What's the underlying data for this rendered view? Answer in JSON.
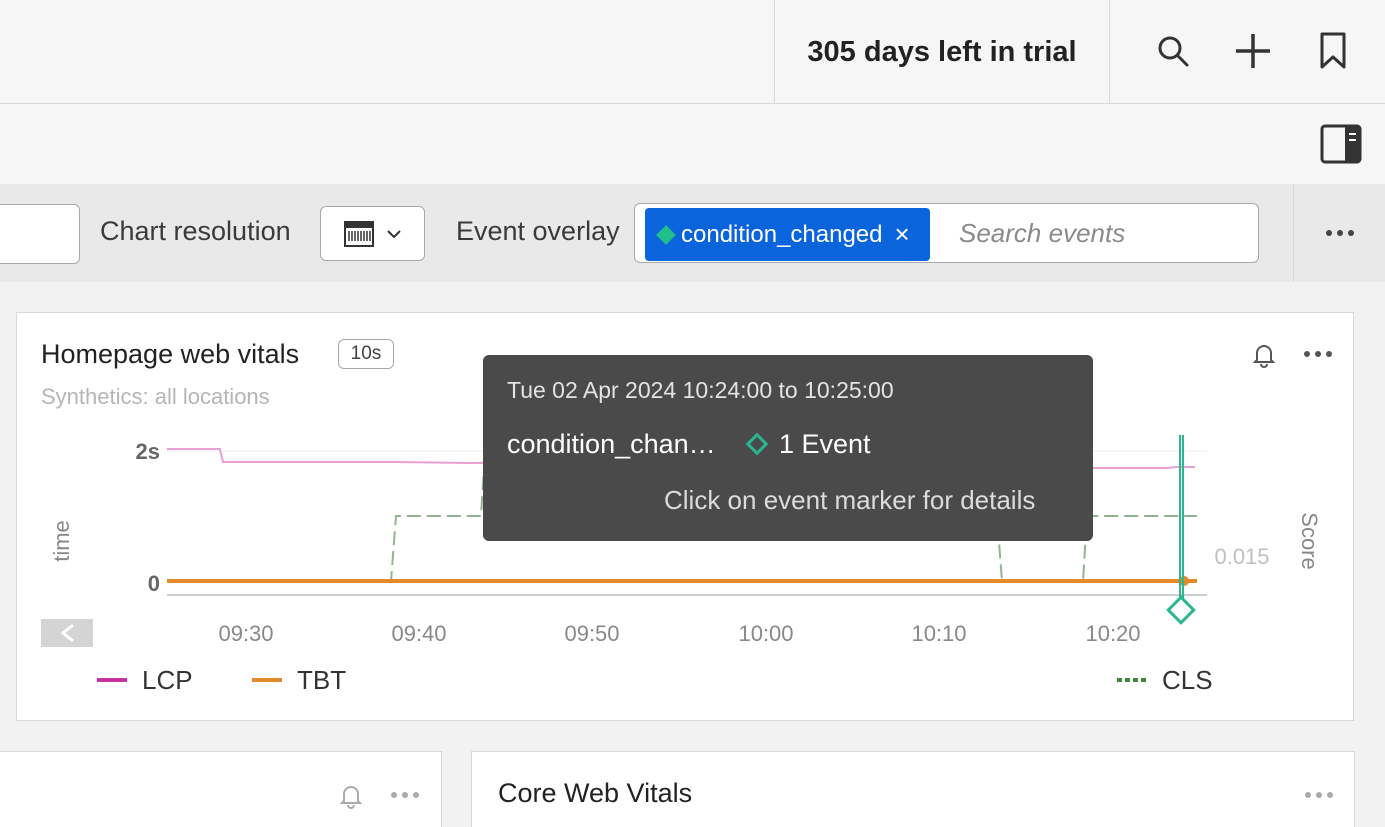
{
  "header": {
    "trial_text": "305 days left in trial",
    "icons": [
      "search-icon",
      "plus-icon",
      "bookmark-icon"
    ]
  },
  "filterbar": {
    "chart_resolution_label": "Chart resolution",
    "event_overlay_label": "Event overlay",
    "event_chip_label": "condition_changed",
    "event_chip_close": "×",
    "search_placeholder": "Search events",
    "accent_color": "#0a64dc"
  },
  "card": {
    "title": "Homepage web vitals",
    "resolution_badge": "10s",
    "subtitle": "Synthetics: all locations",
    "left_axis_title": "time",
    "right_axis_title": "Score",
    "y_ticks": [
      "2s",
      "0"
    ],
    "right_tick": "0.015",
    "x_ticks": [
      "09:30",
      "09:40",
      "09:50",
      "10:00",
      "10:10",
      "10:20"
    ],
    "legend": [
      {
        "name": "LCP",
        "color": "#c3339a"
      },
      {
        "name": "TBT",
        "color": "#e58a2b"
      },
      {
        "name": "CLS",
        "color": "#3d8a3d"
      }
    ]
  },
  "tooltip": {
    "time_range": "Tue 02 Apr 2024 10:24:00 to 10:25:00",
    "event_name": "condition_chan…",
    "event_count": "1 Event",
    "hint": "Click on event marker for details"
  },
  "bottom": {
    "card3_title": "Core Web Vitals"
  },
  "chart_data": {
    "type": "line",
    "x": [
      "09:23",
      "09:30",
      "09:40",
      "09:50",
      "10:00",
      "10:10",
      "10:20",
      "10:24"
    ],
    "series": [
      {
        "name": "LCP",
        "values": [
          2.0,
          1.9,
          1.9,
          1.9,
          1.9,
          1.88,
          1.88,
          1.88
        ]
      },
      {
        "name": "TBT",
        "values": [
          0,
          0,
          0,
          0,
          0,
          0,
          0,
          0
        ]
      },
      {
        "name": "CLS",
        "values": [
          0,
          0,
          0.02,
          0.02,
          0.02,
          0.02,
          0.02,
          0.02
        ]
      }
    ],
    "event_marker_time": "10:24"
  }
}
